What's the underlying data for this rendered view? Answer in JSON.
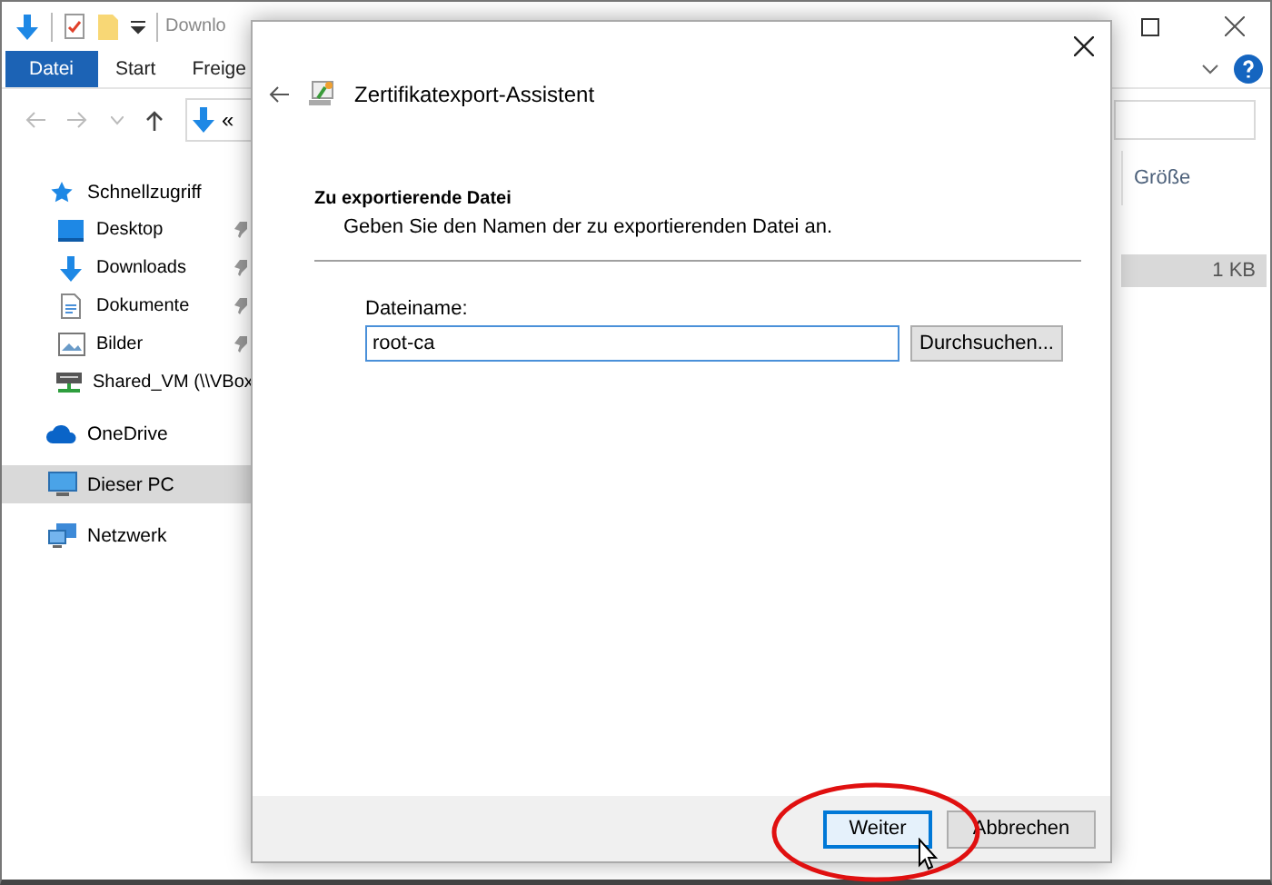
{
  "explorer": {
    "title": "Downlo",
    "ribbon_tabs": [
      {
        "label": "Datei",
        "selected": true
      },
      {
        "label": "Start",
        "selected": false
      },
      {
        "label": "Freige",
        "selected": false
      }
    ],
    "address": "«",
    "sidebar": {
      "items": [
        {
          "label": "Schnellzugriff",
          "selected": false,
          "children": [
            {
              "label": "Desktop",
              "pinned": true,
              "selected": false
            },
            {
              "label": "Downloads",
              "pinned": true,
              "selected": false
            },
            {
              "label": "Dokumente",
              "pinned": true,
              "selected": false
            },
            {
              "label": "Bilder",
              "pinned": true,
              "selected": false
            },
            {
              "label": "Shared_VM (\\\\VBox",
              "selected": false
            }
          ]
        },
        {
          "label": "OneDrive",
          "selected": false
        },
        {
          "label": "Dieser PC",
          "selected": true
        },
        {
          "label": "Netzwerk",
          "selected": false
        }
      ]
    },
    "columns": [
      "Größe"
    ],
    "rows": [
      {
        "size": "1 KB",
        "selected": true
      }
    ]
  },
  "dialog": {
    "title": "Zertifikatexport-Assistent",
    "heading": "Zu exportierende Datei",
    "description": "Geben Sie den Namen der zu exportierenden Datei an.",
    "field": {
      "label": "Dateiname:",
      "value": "root-ca"
    },
    "browse_button": "Durchsuchen...",
    "buttons": [
      {
        "label": "Weiter",
        "focused": true
      },
      {
        "label": "Abbrechen",
        "focused": false
      }
    ]
  }
}
